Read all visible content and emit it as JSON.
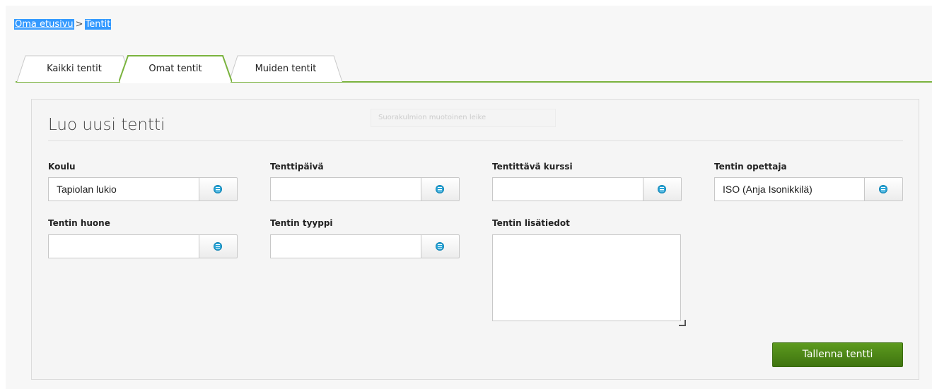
{
  "breadcrumb": {
    "home": "Oma etusivu",
    "separator": ">",
    "current": "Tentit"
  },
  "tabs": [
    {
      "label": "Kaikki tentit",
      "active": false
    },
    {
      "label": "Omat tentit",
      "active": true
    },
    {
      "label": "Muiden tentit",
      "active": false
    }
  ],
  "form": {
    "title": "Luo uusi tentti",
    "ghost_hint": "Suorakulmion muotoinen leike",
    "fields": {
      "koulu": {
        "label": "Koulu",
        "value": "Tapiolan lukio"
      },
      "tenttipaiva": {
        "label": "Tenttipäivä",
        "value": ""
      },
      "kurssi": {
        "label": "Tentittävä kurssi",
        "value": ""
      },
      "opettaja": {
        "label": "Tentin opettaja",
        "value": "ISO (Anja Isonikkilä)"
      },
      "huone": {
        "label": "Tentin huone",
        "value": ""
      },
      "tyyppi": {
        "label": "Tentin tyyppi",
        "value": ""
      },
      "lisatiedot": {
        "label": "Tentin lisätiedot",
        "value": ""
      }
    },
    "save_label": "Tallenna tentti"
  },
  "colors": {
    "accent_green": "#7ab33e",
    "save_green": "#4e8a16",
    "picker_blue": "#2aa6d8",
    "breadcrumb_highlight": "#3399ff"
  },
  "icons": {
    "picker": "list-circle-icon",
    "resize": "resize-grip-icon"
  }
}
